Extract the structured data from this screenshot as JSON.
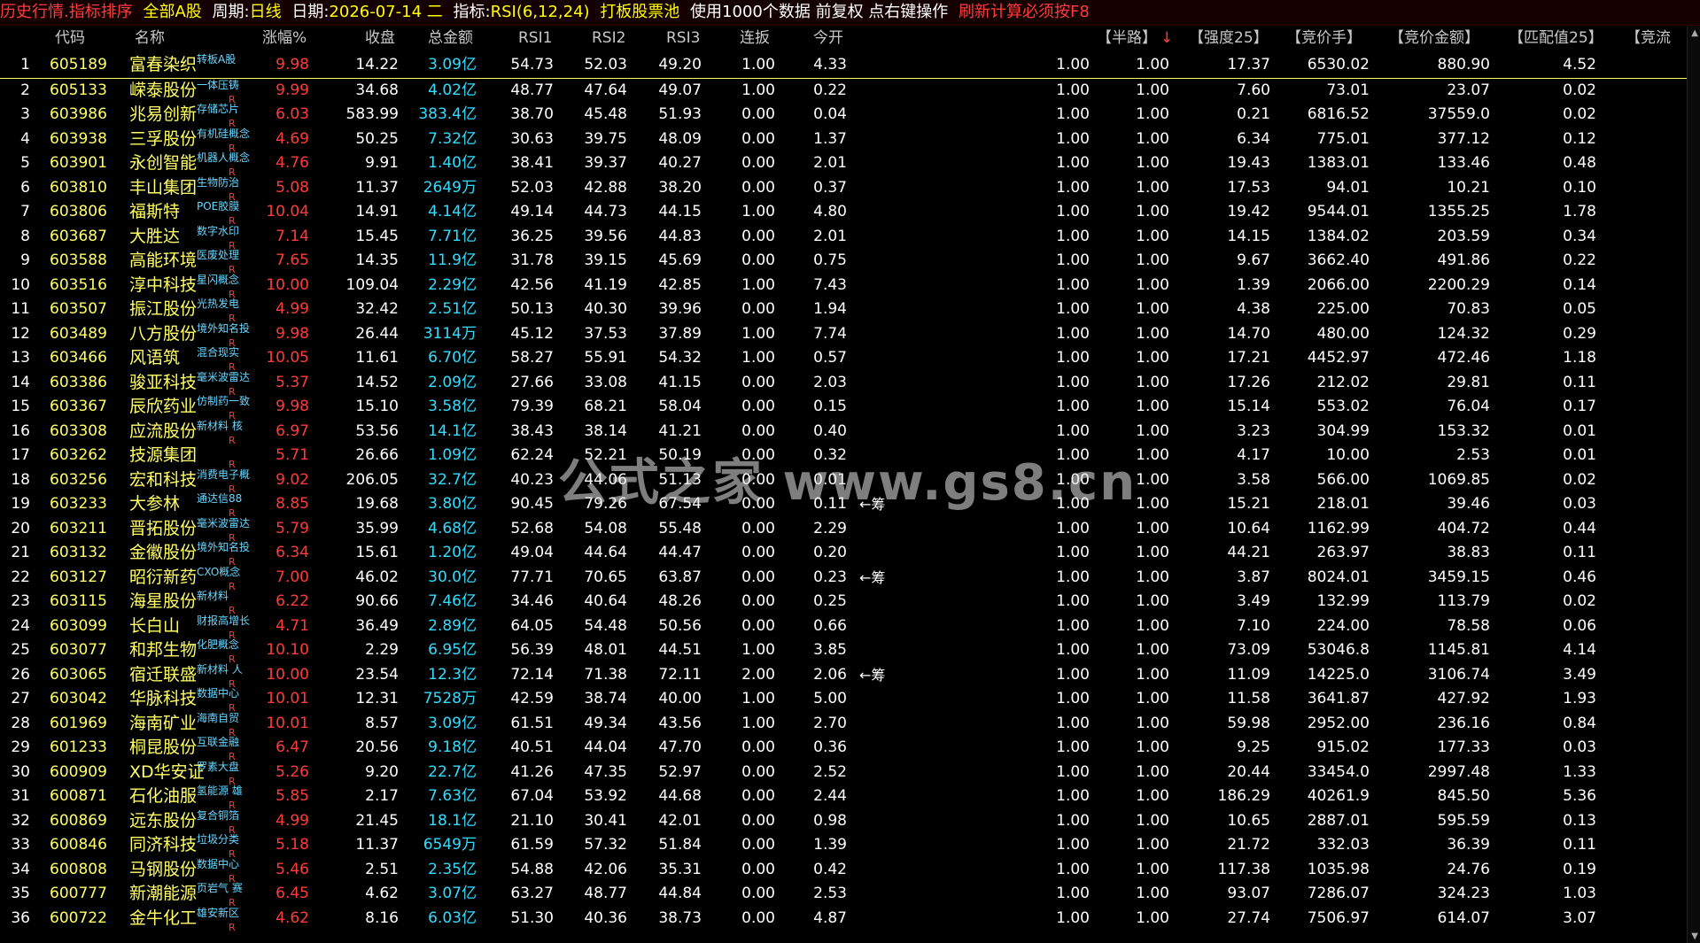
{
  "topbar": {
    "title": "历史行情.指标排序",
    "market": "全部A股",
    "period_label": "周期:",
    "period": "日线",
    "date_label": "日期:",
    "date": "2026-07-14 二",
    "indicator_label": "指标:",
    "indicator": "RSI(6,12,24)",
    "pool": "打板股票池",
    "info": "使用1000个数据 前复权 点右键操作",
    "refresh": "刷新计算必须按F8"
  },
  "columns": {
    "code": "代码",
    "name": "名称",
    "change": "涨幅%",
    "close": "收盘",
    "amount": "总金额",
    "rsi1": "RSI1",
    "rsi2": "RSI2",
    "rsi3": "RSI3",
    "lianban": "连扳",
    "jinkai": "今开",
    "banlu": "【半路】",
    "banlu_sort": "↓",
    "qiangdu": "【强度25】",
    "jingjiashou": "【竞价手】",
    "jingjiajine": "【竞价金额】",
    "pipei": "【匹配值25】",
    "jingliu": "【竞流"
  },
  "rows": [
    {
      "idx": "1",
      "code": "605189",
      "name": "富春染织",
      "tag": "转板A股",
      "chg": "9.98",
      "close": "14.22",
      "amt": "3.09亿",
      "r1": "54.73",
      "r2": "52.03",
      "r3": "49.20",
      "lb": "1.00",
      "jk": "4.33",
      "mark": "",
      "a": "1.00",
      "b": "1.00",
      "q": "17.37",
      "s": "6530.02",
      "j": "880.90",
      "p": "4.52",
      "r": false
    },
    {
      "idx": "2",
      "code": "605133",
      "name": "嵘泰股份",
      "tag": "一体压铸",
      "chg": "9.99",
      "close": "34.68",
      "amt": "4.02亿",
      "r1": "48.77",
      "r2": "47.64",
      "r3": "49.07",
      "lb": "1.00",
      "jk": "0.22",
      "mark": "",
      "a": "1.00",
      "b": "1.00",
      "q": "7.60",
      "s": "73.01",
      "j": "23.07",
      "p": "0.02",
      "r": true
    },
    {
      "idx": "3",
      "code": "603986",
      "name": "兆易创新",
      "tag": "存储芯片",
      "chg": "6.03",
      "close": "583.99",
      "amt": "383.4亿",
      "r1": "38.70",
      "r2": "45.48",
      "r3": "51.93",
      "lb": "0.00",
      "jk": "0.04",
      "mark": "",
      "a": "1.00",
      "b": "1.00",
      "q": "0.21",
      "s": "6816.52",
      "j": "37559.0",
      "p": "0.02",
      "r": true
    },
    {
      "idx": "4",
      "code": "603938",
      "name": "三孚股份",
      "tag": "有机硅概念",
      "chg": "4.69",
      "close": "50.25",
      "amt": "7.32亿",
      "r1": "30.63",
      "r2": "39.75",
      "r3": "48.09",
      "lb": "0.00",
      "jk": "1.37",
      "mark": "",
      "a": "1.00",
      "b": "1.00",
      "q": "6.34",
      "s": "775.01",
      "j": "377.12",
      "p": "0.12",
      "r": true
    },
    {
      "idx": "5",
      "code": "603901",
      "name": "永创智能",
      "tag": "机器人概念",
      "chg": "4.76",
      "close": "9.91",
      "amt": "1.40亿",
      "r1": "38.41",
      "r2": "39.37",
      "r3": "40.27",
      "lb": "0.00",
      "jk": "2.01",
      "mark": "",
      "a": "1.00",
      "b": "1.00",
      "q": "19.43",
      "s": "1383.01",
      "j": "133.46",
      "p": "0.48",
      "r": true
    },
    {
      "idx": "6",
      "code": "603810",
      "name": "丰山集团",
      "tag": "生物防治",
      "chg": "5.08",
      "close": "11.37",
      "amt": "2649万",
      "r1": "52.03",
      "r2": "42.88",
      "r3": "38.20",
      "lb": "0.00",
      "jk": "0.37",
      "mark": "",
      "a": "1.00",
      "b": "1.00",
      "q": "17.53",
      "s": "94.01",
      "j": "10.21",
      "p": "0.10",
      "r": true
    },
    {
      "idx": "7",
      "code": "603806",
      "name": "福斯特",
      "tag": "POE胶膜",
      "chg": "10.04",
      "close": "14.91",
      "amt": "4.14亿",
      "r1": "49.14",
      "r2": "44.73",
      "r3": "44.15",
      "lb": "1.00",
      "jk": "4.80",
      "mark": "",
      "a": "1.00",
      "b": "1.00",
      "q": "19.42",
      "s": "9544.01",
      "j": "1355.25",
      "p": "1.78",
      "r": true
    },
    {
      "idx": "8",
      "code": "603687",
      "name": "大胜达",
      "tag": "数字水印",
      "chg": "7.14",
      "close": "15.45",
      "amt": "7.71亿",
      "r1": "36.25",
      "r2": "39.56",
      "r3": "44.83",
      "lb": "0.00",
      "jk": "2.01",
      "mark": "",
      "a": "1.00",
      "b": "1.00",
      "q": "14.15",
      "s": "1384.02",
      "j": "203.59",
      "p": "0.34",
      "r": true
    },
    {
      "idx": "9",
      "code": "603588",
      "name": "高能环境",
      "tag": "医废处理",
      "chg": "7.65",
      "close": "14.35",
      "amt": "11.9亿",
      "r1": "31.78",
      "r2": "39.15",
      "r3": "45.69",
      "lb": "0.00",
      "jk": "0.75",
      "mark": "",
      "a": "1.00",
      "b": "1.00",
      "q": "9.67",
      "s": "3662.40",
      "j": "491.86",
      "p": "0.22",
      "r": true
    },
    {
      "idx": "10",
      "code": "603516",
      "name": "淳中科技",
      "tag": "星闪概念",
      "chg": "10.00",
      "close": "109.04",
      "amt": "2.29亿",
      "r1": "42.56",
      "r2": "41.19",
      "r3": "42.85",
      "lb": "1.00",
      "jk": "7.43",
      "mark": "",
      "a": "1.00",
      "b": "1.00",
      "q": "1.39",
      "s": "2066.00",
      "j": "2200.29",
      "p": "0.14",
      "r": true
    },
    {
      "idx": "11",
      "code": "603507",
      "name": "振江股份",
      "tag": "光热发电",
      "chg": "4.99",
      "close": "32.42",
      "amt": "2.51亿",
      "r1": "50.13",
      "r2": "40.30",
      "r3": "39.96",
      "lb": "0.00",
      "jk": "1.94",
      "mark": "",
      "a": "1.00",
      "b": "1.00",
      "q": "4.38",
      "s": "225.00",
      "j": "70.83",
      "p": "0.05",
      "r": true
    },
    {
      "idx": "12",
      "code": "603489",
      "name": "八方股份",
      "tag": "境外知名投",
      "chg": "9.98",
      "close": "26.44",
      "amt": "3114万",
      "r1": "45.12",
      "r2": "37.53",
      "r3": "37.89",
      "lb": "1.00",
      "jk": "7.74",
      "mark": "",
      "a": "1.00",
      "b": "1.00",
      "q": "14.70",
      "s": "480.00",
      "j": "124.32",
      "p": "0.29",
      "r": true
    },
    {
      "idx": "13",
      "code": "603466",
      "name": "风语筑",
      "tag": "混合现实",
      "chg": "10.05",
      "close": "11.61",
      "amt": "6.70亿",
      "r1": "58.27",
      "r2": "55.91",
      "r3": "54.32",
      "lb": "1.00",
      "jk": "0.57",
      "mark": "",
      "a": "1.00",
      "b": "1.00",
      "q": "17.21",
      "s": "4452.97",
      "j": "472.46",
      "p": "1.18",
      "r": true
    },
    {
      "idx": "14",
      "code": "603386",
      "name": "骏亚科技",
      "tag": "毫米波雷达",
      "chg": "5.37",
      "close": "14.52",
      "amt": "2.09亿",
      "r1": "27.66",
      "r2": "33.08",
      "r3": "41.15",
      "lb": "0.00",
      "jk": "2.03",
      "mark": "",
      "a": "1.00",
      "b": "1.00",
      "q": "17.26",
      "s": "212.02",
      "j": "29.81",
      "p": "0.11",
      "r": true
    },
    {
      "idx": "15",
      "code": "603367",
      "name": "辰欣药业",
      "tag": "仿制药一致",
      "chg": "9.98",
      "close": "15.10",
      "amt": "3.58亿",
      "r1": "79.39",
      "r2": "68.21",
      "r3": "58.04",
      "lb": "0.00",
      "jk": "0.15",
      "mark": "",
      "a": "1.00",
      "b": "1.00",
      "q": "15.14",
      "s": "553.02",
      "j": "76.04",
      "p": "0.17",
      "r": true
    },
    {
      "idx": "16",
      "code": "603308",
      "name": "应流股份",
      "tag": "新材料 核",
      "chg": "6.97",
      "close": "53.56",
      "amt": "14.1亿",
      "r1": "38.43",
      "r2": "38.14",
      "r3": "41.21",
      "lb": "0.00",
      "jk": "0.40",
      "mark": "",
      "a": "1.00",
      "b": "1.00",
      "q": "3.23",
      "s": "304.99",
      "j": "153.32",
      "p": "0.01",
      "r": true
    },
    {
      "idx": "17",
      "code": "603262",
      "name": "技源集团",
      "tag": "",
      "chg": "5.71",
      "close": "26.66",
      "amt": "1.09亿",
      "r1": "62.24",
      "r2": "52.21",
      "r3": "50.19",
      "lb": "0.00",
      "jk": "0.32",
      "mark": "",
      "a": "1.00",
      "b": "1.00",
      "q": "4.17",
      "s": "10.00",
      "j": "2.53",
      "p": "0.01",
      "r": true
    },
    {
      "idx": "18",
      "code": "603256",
      "name": "宏和科技",
      "tag": "消费电子概",
      "chg": "9.02",
      "close": "206.05",
      "amt": "32.7亿",
      "r1": "40.23",
      "r2": "44.06",
      "r3": "51.13",
      "lb": "0.00",
      "jk": "0.01",
      "mark": "",
      "a": "1.00",
      "b": "1.00",
      "q": "3.58",
      "s": "566.00",
      "j": "1069.85",
      "p": "0.02",
      "r": true
    },
    {
      "idx": "19",
      "code": "603233",
      "name": "大参林",
      "tag": "通达信88",
      "chg": "8.85",
      "close": "19.68",
      "amt": "3.80亿",
      "r1": "90.45",
      "r2": "79.26",
      "r3": "67.54",
      "lb": "0.00",
      "jk": "0.11",
      "mark": "←筹",
      "a": "1.00",
      "b": "1.00",
      "q": "15.21",
      "s": "218.01",
      "j": "39.46",
      "p": "0.03",
      "r": true
    },
    {
      "idx": "20",
      "code": "603211",
      "name": "晋拓股份",
      "tag": "毫米波雷达",
      "chg": "5.79",
      "close": "35.99",
      "amt": "4.68亿",
      "r1": "52.68",
      "r2": "54.08",
      "r3": "55.48",
      "lb": "0.00",
      "jk": "2.29",
      "mark": "",
      "a": "1.00",
      "b": "1.00",
      "q": "10.64",
      "s": "1162.99",
      "j": "404.72",
      "p": "0.44",
      "r": true
    },
    {
      "idx": "21",
      "code": "603132",
      "name": "金徽股份",
      "tag": "境外知名投",
      "chg": "6.34",
      "close": "15.61",
      "amt": "1.20亿",
      "r1": "49.04",
      "r2": "44.64",
      "r3": "44.47",
      "lb": "0.00",
      "jk": "0.20",
      "mark": "",
      "a": "1.00",
      "b": "1.00",
      "q": "44.21",
      "s": "263.97",
      "j": "38.83",
      "p": "0.11",
      "r": true
    },
    {
      "idx": "22",
      "code": "603127",
      "name": "昭衍新药",
      "tag": "CXO概念",
      "chg": "7.00",
      "close": "46.02",
      "amt": "30.0亿",
      "r1": "77.71",
      "r2": "70.65",
      "r3": "63.87",
      "lb": "0.00",
      "jk": "0.23",
      "mark": "←筹",
      "a": "1.00",
      "b": "1.00",
      "q": "3.87",
      "s": "8024.01",
      "j": "3459.15",
      "p": "0.46",
      "r": true
    },
    {
      "idx": "23",
      "code": "603115",
      "name": "海星股份",
      "tag": "新材料",
      "chg": "6.22",
      "close": "90.66",
      "amt": "7.46亿",
      "r1": "34.46",
      "r2": "40.64",
      "r3": "48.26",
      "lb": "0.00",
      "jk": "0.25",
      "mark": "",
      "a": "1.00",
      "b": "1.00",
      "q": "3.49",
      "s": "132.99",
      "j": "113.79",
      "p": "0.02",
      "r": true
    },
    {
      "idx": "24",
      "code": "603099",
      "name": "长白山",
      "tag": "财报高增长",
      "chg": "4.71",
      "close": "36.49",
      "amt": "2.89亿",
      "r1": "64.05",
      "r2": "54.48",
      "r3": "50.56",
      "lb": "0.00",
      "jk": "0.66",
      "mark": "",
      "a": "1.00",
      "b": "1.00",
      "q": "7.10",
      "s": "224.00",
      "j": "78.58",
      "p": "0.06",
      "r": true
    },
    {
      "idx": "25",
      "code": "603077",
      "name": "和邦生物",
      "tag": "化肥概念",
      "chg": "10.10",
      "close": "2.29",
      "amt": "6.95亿",
      "r1": "56.39",
      "r2": "48.01",
      "r3": "44.51",
      "lb": "1.00",
      "jk": "3.85",
      "mark": "",
      "a": "1.00",
      "b": "1.00",
      "q": "73.09",
      "s": "53046.8",
      "j": "1145.81",
      "p": "4.14",
      "r": true
    },
    {
      "idx": "26",
      "code": "603065",
      "name": "宿迁联盛",
      "tag": "新材料 人",
      "chg": "10.00",
      "close": "23.54",
      "amt": "12.3亿",
      "r1": "72.14",
      "r2": "71.38",
      "r3": "72.11",
      "lb": "2.00",
      "jk": "2.06",
      "mark": "←筹",
      "a": "1.00",
      "b": "1.00",
      "q": "11.09",
      "s": "14225.0",
      "j": "3106.74",
      "p": "3.49",
      "r": true
    },
    {
      "idx": "27",
      "code": "603042",
      "name": "华脉科技",
      "tag": "数据中心",
      "chg": "10.01",
      "close": "12.31",
      "amt": "7528万",
      "r1": "42.59",
      "r2": "38.74",
      "r3": "40.00",
      "lb": "1.00",
      "jk": "5.00",
      "mark": "",
      "a": "1.00",
      "b": "1.00",
      "q": "11.58",
      "s": "3641.87",
      "j": "427.92",
      "p": "1.93",
      "r": true
    },
    {
      "idx": "28",
      "code": "601969",
      "name": "海南矿业",
      "tag": "海南自贸",
      "chg": "10.01",
      "close": "8.57",
      "amt": "3.09亿",
      "r1": "61.51",
      "r2": "49.34",
      "r3": "43.56",
      "lb": "1.00",
      "jk": "2.70",
      "mark": "",
      "a": "1.00",
      "b": "1.00",
      "q": "59.98",
      "s": "2952.00",
      "j": "236.16",
      "p": "0.84",
      "r": true
    },
    {
      "idx": "29",
      "code": "601233",
      "name": "桐昆股份",
      "tag": "互联金融",
      "chg": "6.47",
      "close": "20.56",
      "amt": "9.18亿",
      "r1": "40.51",
      "r2": "44.04",
      "r3": "47.70",
      "lb": "0.00",
      "jk": "0.36",
      "mark": "",
      "a": "1.00",
      "b": "1.00",
      "q": "9.25",
      "s": "915.02",
      "j": "177.33",
      "p": "0.03",
      "r": true
    },
    {
      "idx": "30",
      "code": "600909",
      "name": "XD华安证",
      "tag": "罗素大盘",
      "chg": "5.26",
      "close": "9.20",
      "amt": "22.7亿",
      "r1": "41.26",
      "r2": "47.35",
      "r3": "52.97",
      "lb": "0.00",
      "jk": "2.52",
      "mark": "",
      "a": "1.00",
      "b": "1.00",
      "q": "20.44",
      "s": "33454.0",
      "j": "2997.48",
      "p": "1.33",
      "r": true
    },
    {
      "idx": "31",
      "code": "600871",
      "name": "石化油服",
      "tag": "氢能源 雄",
      "chg": "5.85",
      "close": "2.17",
      "amt": "7.63亿",
      "r1": "67.04",
      "r2": "53.92",
      "r3": "44.68",
      "lb": "0.00",
      "jk": "2.44",
      "mark": "",
      "a": "1.00",
      "b": "1.00",
      "q": "186.29",
      "s": "40261.9",
      "j": "845.50",
      "p": "5.36",
      "r": true
    },
    {
      "idx": "32",
      "code": "600869",
      "name": "远东股份",
      "tag": "复合铜箔",
      "chg": "4.99",
      "close": "21.45",
      "amt": "18.1亿",
      "r1": "21.10",
      "r2": "30.41",
      "r3": "42.01",
      "lb": "0.00",
      "jk": "0.98",
      "mark": "",
      "a": "1.00",
      "b": "1.00",
      "q": "10.65",
      "s": "2887.01",
      "j": "595.59",
      "p": "0.13",
      "r": true
    },
    {
      "idx": "33",
      "code": "600846",
      "name": "同济科技",
      "tag": "垃圾分类",
      "chg": "5.18",
      "close": "11.37",
      "amt": "6549万",
      "r1": "61.59",
      "r2": "57.32",
      "r3": "51.84",
      "lb": "0.00",
      "jk": "1.39",
      "mark": "",
      "a": "1.00",
      "b": "1.00",
      "q": "21.72",
      "s": "332.03",
      "j": "36.39",
      "p": "0.11",
      "r": true
    },
    {
      "idx": "34",
      "code": "600808",
      "name": "马钢股份",
      "tag": "数据中心",
      "chg": "5.46",
      "close": "2.51",
      "amt": "2.35亿",
      "r1": "54.88",
      "r2": "42.06",
      "r3": "35.31",
      "lb": "0.00",
      "jk": "0.42",
      "mark": "",
      "a": "1.00",
      "b": "1.00",
      "q": "117.38",
      "s": "1035.98",
      "j": "24.76",
      "p": "0.19",
      "r": true
    },
    {
      "idx": "35",
      "code": "600777",
      "name": "新潮能源",
      "tag": "页岩气 赛",
      "chg": "6.45",
      "close": "4.62",
      "amt": "3.07亿",
      "r1": "63.27",
      "r2": "48.77",
      "r3": "44.84",
      "lb": "0.00",
      "jk": "2.53",
      "mark": "",
      "a": "1.00",
      "b": "1.00",
      "q": "93.07",
      "s": "7286.07",
      "j": "324.23",
      "p": "1.03",
      "r": true
    },
    {
      "idx": "36",
      "code": "600722",
      "name": "金牛化工",
      "tag": "雄安新区",
      "chg": "4.62",
      "close": "8.16",
      "amt": "6.03亿",
      "r1": "51.30",
      "r2": "40.36",
      "r3": "38.73",
      "lb": "0.00",
      "jk": "4.87",
      "mark": "",
      "a": "1.00",
      "b": "1.00",
      "q": "27.74",
      "s": "7506.97",
      "j": "614.07",
      "p": "3.07",
      "r": true
    }
  ],
  "watermark": "公式之家 www.gs8.cn",
  "colors": {
    "up": "#ff3b3b",
    "code": "#ffff66",
    "amount": "#33ddff",
    "tag": "#67d7ff"
  }
}
